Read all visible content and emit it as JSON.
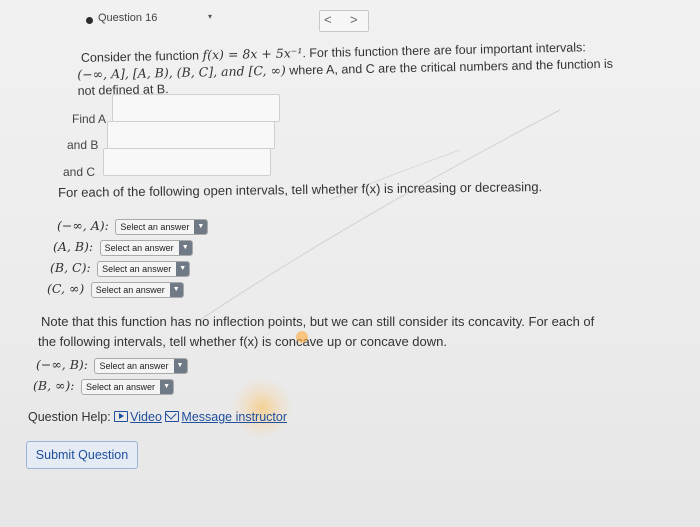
{
  "header": {
    "question_title": "Question 16",
    "dropdown_glyph": "▾",
    "prev_glyph": "<",
    "next_glyph": ">"
  },
  "intro": {
    "line1_prefix": "Consider the function ",
    "function_expr": "f(x) = 8x + 5x⁻¹",
    "line1_suffix": ". For this function there are four important intervals:",
    "line2_intervals": "(−∞, A], [A, B), (B, C], and [C, ∞)",
    "line2_suffix": " where A, and C are the critical numbers and the function is",
    "line3": "not defined at B."
  },
  "critical": {
    "find_a_label": "Find A",
    "and_b_label": "and B",
    "and_c_label": "and C",
    "a_value": "",
    "b_value": "",
    "c_value": ""
  },
  "increasing": {
    "prompt": "For each of the following open intervals, tell whether f(x) is increasing or decreasing.",
    "rows": [
      {
        "interval": "(−∞, A):",
        "selected": "Select an answer"
      },
      {
        "interval": "(A, B):",
        "selected": "Select an answer"
      },
      {
        "interval": "(B, C):",
        "selected": "Select an answer"
      },
      {
        "interval": "(C, ∞)",
        "selected": "Select an answer"
      }
    ]
  },
  "concavity": {
    "line1": "Note that this function has no inflection points, but we can still consider its concavity. For each of",
    "line2": "the following intervals, tell whether f(x) is concave up or concave down.",
    "rows": [
      {
        "interval": "(−∞, B):",
        "selected": "Select an answer"
      },
      {
        "interval": "(B, ∞):",
        "selected": "Select an answer"
      }
    ]
  },
  "help": {
    "label": "Question Help:",
    "video_link": "Video",
    "message_link": "Message instructor"
  },
  "submit_label": "Submit Question",
  "colors": {
    "link": "#1f4e9c",
    "select_arrow_bg": "#6f7a86",
    "submit_bg": "#e4ebf5"
  }
}
